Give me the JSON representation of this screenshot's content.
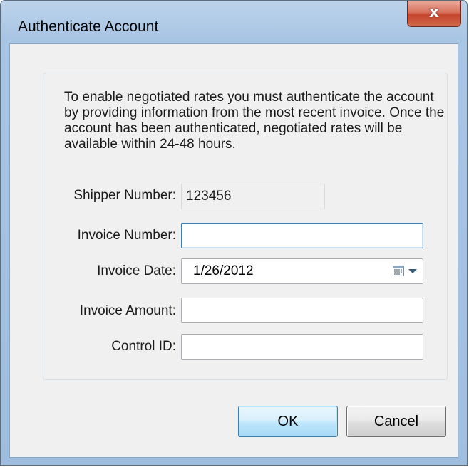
{
  "window": {
    "title": "Authenticate Account",
    "close_label": "x"
  },
  "description": "To enable negotiated rates you must authenticate the account by providing information from the most recent invoice. Once the account has been authenticated, negotiated rates will be available within 24-48 hours.",
  "form": {
    "shipper_number": {
      "label": "Shipper Number:",
      "value": "123456"
    },
    "invoice_number": {
      "label": "Invoice Number:",
      "value": ""
    },
    "invoice_date": {
      "label": "Invoice Date:",
      "value": "1/26/2012"
    },
    "invoice_amount": {
      "label": "Invoice Amount:",
      "value": ""
    },
    "control_id": {
      "label": "Control ID:",
      "value": ""
    }
  },
  "buttons": {
    "ok": "OK",
    "cancel": "Cancel"
  },
  "icons": {
    "close": "close-icon",
    "calendar": "calendar-icon",
    "dropdown": "chevron-down-icon"
  },
  "colors": {
    "title_bar": "#a9c5e4",
    "close_button": "#c5452c",
    "focus_border": "#3c7fb1",
    "dialog_bg": "#f0f0f0"
  }
}
